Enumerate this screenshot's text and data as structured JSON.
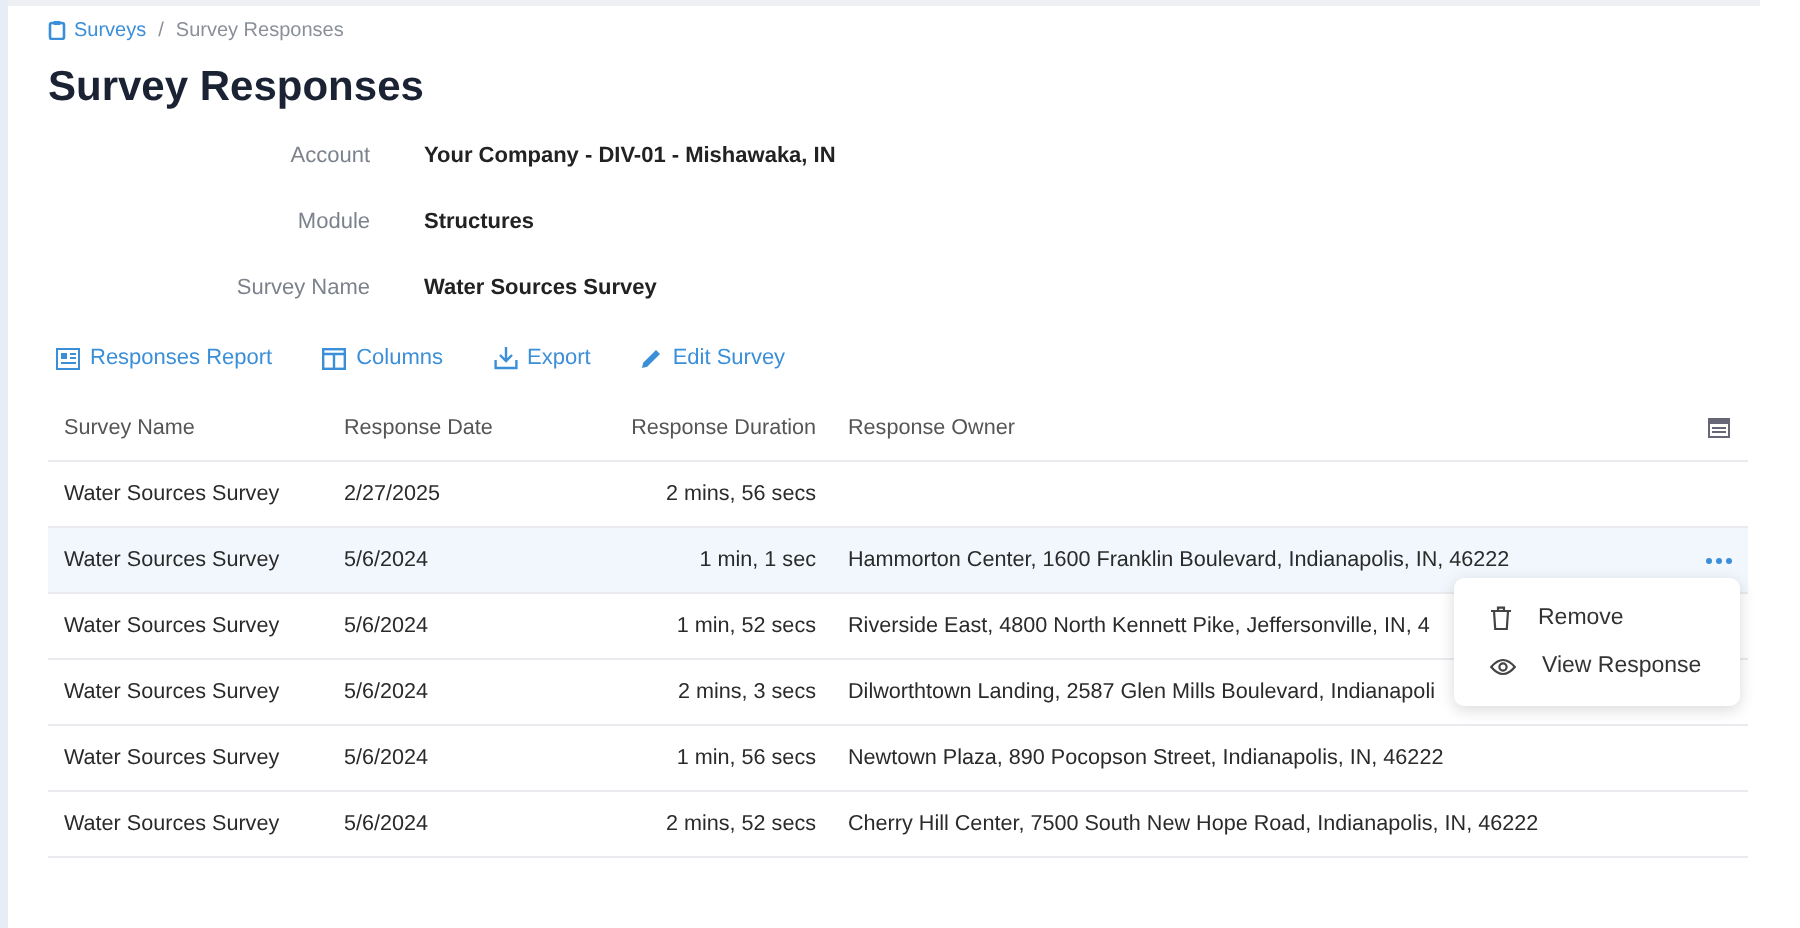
{
  "breadcrumb_separator": "/",
  "breadcrumb": [
    {
      "label": "Surveys",
      "kind": "link"
    },
    {
      "label": "Survey Responses",
      "kind": "current"
    }
  ],
  "title": "Survey Responses",
  "details": [
    {
      "label": "Account",
      "value": "Your Company - DIV-01 - Mishawaka, IN"
    },
    {
      "label": "Module",
      "value": "Structures"
    },
    {
      "label": "Survey Name",
      "value": "Water Sources Survey"
    }
  ],
  "toolbar": [
    {
      "label": "Responses Report",
      "kind": "report"
    },
    {
      "label": "Columns",
      "kind": "columns"
    },
    {
      "label": "Export",
      "kind": "export"
    },
    {
      "label": "Edit Survey",
      "kind": "edit"
    }
  ],
  "table": {
    "columns": [
      "Survey Name",
      "Response Date",
      "Response Duration",
      "Response Owner"
    ],
    "rows": [
      {
        "cells": [
          "Water Sources Survey",
          "2/27/2025",
          "2 mins, 56 secs",
          ""
        ],
        "highlighted": false
      },
      {
        "cells": [
          "Water Sources Survey",
          "5/6/2024",
          "1 min, 1 sec",
          "Hammorton Center, 1600 Franklin Boulevard, Indianapolis, IN, 46222"
        ],
        "highlighted": true,
        "menu_open": true
      },
      {
        "cells": [
          "Water Sources Survey",
          "5/6/2024",
          "1 min, 52 secs",
          "Riverside East, 4800 North Kennett Pike, Jeffersonville, IN, 4"
        ],
        "highlighted": false
      },
      {
        "cells": [
          "Water Sources Survey",
          "5/6/2024",
          "2 mins, 3 secs",
          "Dilworthtown Landing, 2587 Glen Mills Boulevard, Indianapoli"
        ],
        "highlighted": false
      },
      {
        "cells": [
          "Water Sources Survey",
          "5/6/2024",
          "1 min, 56 secs",
          "Newtown Plaza, 890 Pocopson Street, Indianapolis, IN, 46222"
        ],
        "highlighted": false
      },
      {
        "cells": [
          "Water Sources Survey",
          "5/6/2024",
          "2 mins, 52 secs",
          "Cherry Hill Center, 7500 South New Hope Road, Indianapolis, IN, 46222"
        ],
        "highlighted": false
      }
    ]
  },
  "row_menu": {
    "items": [
      {
        "label": "Remove",
        "kind": "remove"
      },
      {
        "label": "View Response",
        "kind": "view"
      }
    ]
  }
}
